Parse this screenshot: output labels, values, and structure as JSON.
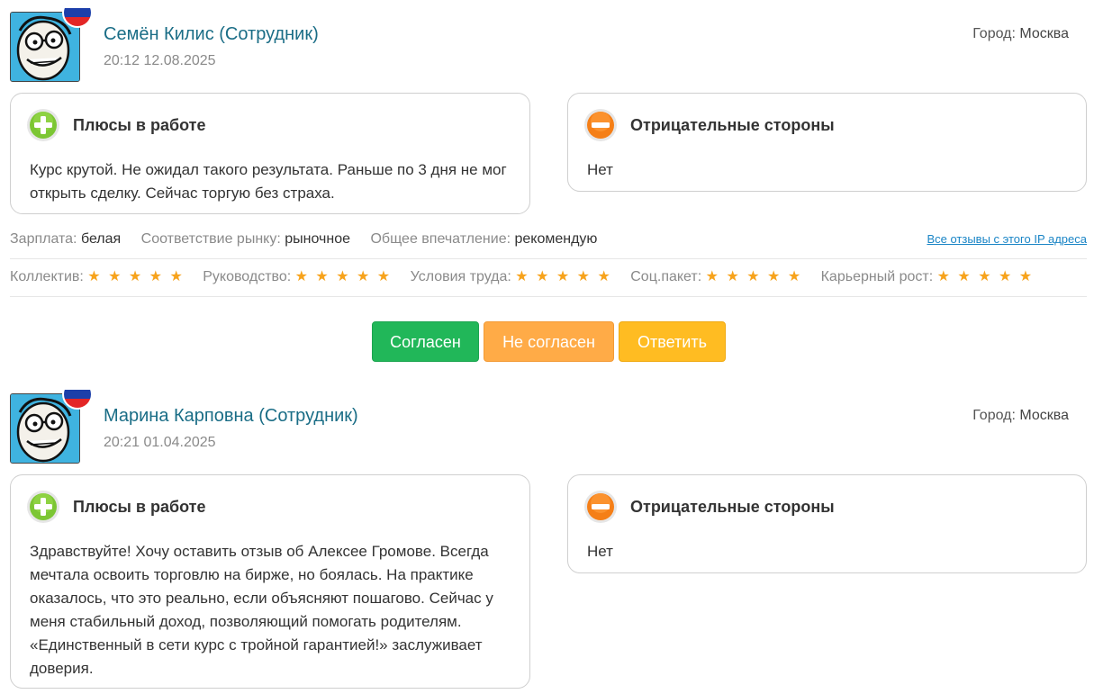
{
  "colors": {
    "name": "#1a6d86",
    "agree": "#21b759",
    "disagree": "#ffab47",
    "reply": "#ffbc22",
    "star": "#f7a31c",
    "link": "#1a85c6",
    "pros_icon": "#7cc634",
    "cons_icon": "#f57f17"
  },
  "icons": {
    "plus": "plus-circle-icon",
    "minus": "minus-circle-icon",
    "flag": "russia-flag-icon",
    "avatar": "cartoon-avatar-icon"
  },
  "labels": {
    "pros_title": "Плюсы в работе",
    "cons_title": "Отрицательные стороны",
    "city_label": "Город:",
    "salary_label": "Зарплата:",
    "market_label": "Соответствие рынку:",
    "impression_label": "Общее впечатление:",
    "ip_link": "Все отзывы с этого IP адреса",
    "team": "Коллектив:",
    "management": "Руководство:",
    "conditions": "Условия труда:",
    "social": "Соц.пакет:",
    "career": "Карьерный рост:",
    "stars": "★ ★ ★ ★ ★",
    "agree": "Согласен",
    "disagree": "Не согласен",
    "reply": "Ответить"
  },
  "reviews": [
    {
      "name": "Семён Килис (Сотрудник)",
      "date": "20:12 12.08.2025",
      "city": "Москва",
      "pros": "Курс крутой. Не ожидал такого результата. Раньше по 3 дня не мог открыть сделку. Сейчас торгую без страха.",
      "cons": "Нет",
      "salary": "белая",
      "market": "рыночное",
      "impression": "рекомендую",
      "ratings": {
        "team": 5,
        "management": 5,
        "conditions": 5,
        "social": 5,
        "career": 5
      }
    },
    {
      "name": "Марина Карповна (Сотрудник)",
      "date": "20:21 01.04.2025",
      "city": "Москва",
      "pros": "Здравствуйте! Хочу оставить отзыв об Алексее Громове. Всегда мечтала освоить торговлю на бирже, но боялась. На практике оказалось, что это реально, если объясняют пошагово. Сейчас у меня стабильный доход, позволяющий помогать родителям. «Единственный в сети курс с тройной гарантией!» заслуживает доверия.",
      "cons": "Нет"
    }
  ]
}
